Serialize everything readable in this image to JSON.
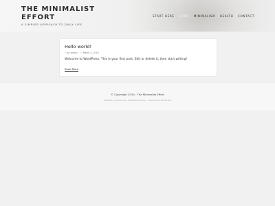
{
  "header": {
    "site_title": "THE MINIMALIST EFFORT",
    "tagline": "A SIMPLER APPROACH TO DAILY LIFE"
  },
  "nav": {
    "items": [
      {
        "label": "START HERE"
      },
      {
        "label": "HOME"
      },
      {
        "label": "MINIMALISM"
      },
      {
        "label": "HEALTH"
      },
      {
        "label": "CONTACT"
      }
    ]
  },
  "post": {
    "title": "Hello world!",
    "author": "by admin",
    "date": "March 4, 2019",
    "excerpt": "Welcome to WordPress. This is your first post. Edit or delete it, then start writing!",
    "read_more": "Read More"
  },
  "footer": {
    "copyright": "© Copyright 2019 - The Minimalist Effort",
    "credits": "Aesthetic | Powered by ashthemes Press... Powered by WordPress"
  },
  "icons": {
    "author": "user-icon",
    "date": "calendar-icon"
  }
}
